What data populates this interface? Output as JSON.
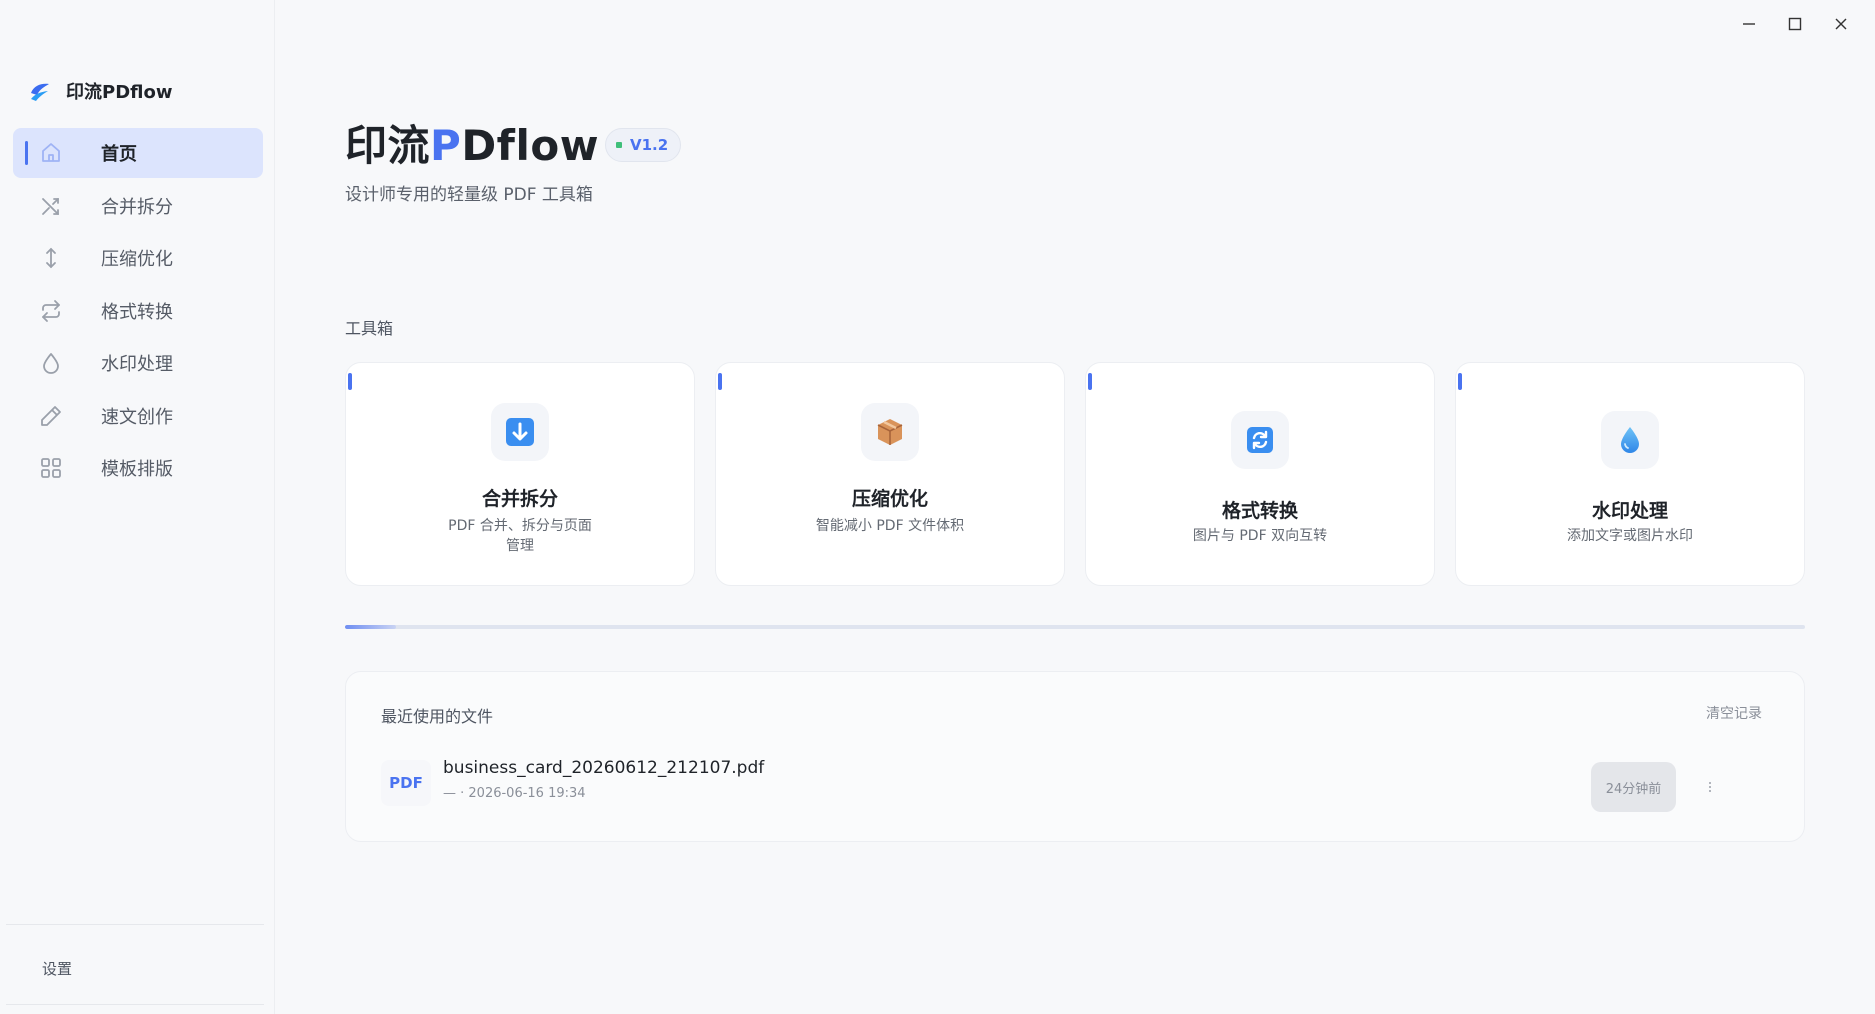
{
  "app": {
    "name": "印流PDflow",
    "colors": {
      "accent": "#4a73f0",
      "active_bg": "#dce4fd",
      "status_dot": "#3fbf7a"
    }
  },
  "window_controls": {
    "minimize_icon": "minimize-icon",
    "maximize_icon": "maximize-icon",
    "close_icon": "close-icon"
  },
  "sidebar": {
    "items": [
      {
        "label": "首页",
        "icon": "home-icon",
        "active": true
      },
      {
        "label": "合并拆分",
        "icon": "shuffle-icon",
        "active": false
      },
      {
        "label": "压缩优化",
        "icon": "vertical-arrows-icon",
        "active": false
      },
      {
        "label": "格式转换",
        "icon": "repeat-icon",
        "active": false
      },
      {
        "label": "水印处理",
        "icon": "droplet-icon",
        "active": false
      },
      {
        "label": "速文创作",
        "icon": "pen-icon",
        "active": false
      },
      {
        "label": "模板排版",
        "icon": "grid-icon",
        "active": false
      }
    ],
    "settings_label": "设置"
  },
  "hero": {
    "title_prefix": "印流",
    "title_accent": "P",
    "title_suffix": "Dflow",
    "version": "V1.2",
    "subtitle": "设计师专用的轻量级 PDF 工具箱"
  },
  "toolbox": {
    "label": "工具箱",
    "cards": [
      {
        "title": "合并拆分",
        "desc": "PDF 合并、拆分与页面管理",
        "icon": "download-arrow-icon"
      },
      {
        "title": "压缩优化",
        "desc": "智能减小 PDF 文件体积",
        "icon": "package-icon"
      },
      {
        "title": "格式转换",
        "desc": "图片与 PDF 双向互转",
        "icon": "refresh-icon"
      },
      {
        "title": "水印处理",
        "desc": "添加文字或图片水印",
        "icon": "droplet-icon"
      }
    ]
  },
  "progress": {
    "value": 0.035
  },
  "recent": {
    "title": "最近使用的文件",
    "clear_label": "清空记录",
    "files": [
      {
        "type": "PDF",
        "name": "business_card_20260612_212107.pdf",
        "meta": "— · 2026-06-16 19:34",
        "time_ago": "24分钟前",
        "more_icon": "more-vertical-icon"
      }
    ]
  }
}
